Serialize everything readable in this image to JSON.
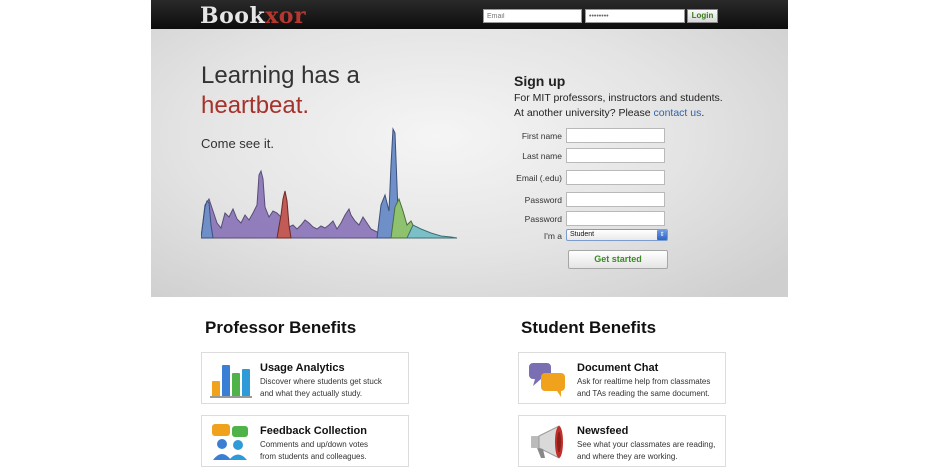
{
  "header": {
    "logo_main": "Book",
    "logo_accent": "xor",
    "email_placeholder": "Email",
    "password_mask": "••••••••",
    "login_label": "Login"
  },
  "hero": {
    "headline_line1": "Learning has a",
    "headline_line2": "heartbeat.",
    "come_see": "Come see it."
  },
  "signup": {
    "title": "Sign up",
    "subtitle_line1": "For MIT professors, instructors and students.",
    "subtitle_prefix": "At another university? Please ",
    "contact_link": "contact us",
    "subtitle_suffix": ".",
    "fields": [
      {
        "label": "First name"
      },
      {
        "label": "Last name"
      },
      {
        "label": "Email (.edu)"
      },
      {
        "label": "Password"
      },
      {
        "label": "Password"
      }
    ],
    "role_label": "I'm a",
    "role_value": "Student",
    "submit_label": "Get started"
  },
  "benefits": {
    "professor_title": "Professor Benefits",
    "student_title": "Student Benefits",
    "professor_items": [
      {
        "title": "Usage Analytics",
        "desc_line1": "Discover where students get stuck",
        "desc_line2": "and what they actually study.",
        "icon": "bar-chart-icon"
      },
      {
        "title": "Feedback Collection",
        "desc_line1": "Comments and up/down votes",
        "desc_line2": "from students and colleagues.",
        "icon": "people-chat-icon"
      }
    ],
    "student_items": [
      {
        "title": "Document Chat",
        "desc_line1": "Ask for realtime help from classmates",
        "desc_line2": "and TAs reading the same document.",
        "icon": "chat-bubbles-icon"
      },
      {
        "title": "Newsfeed",
        "desc_line1": "See what your classmates are reading,",
        "desc_line2": "and where they are working.",
        "icon": "megaphone-icon"
      }
    ]
  },
  "colors": {
    "brand_red": "#a5322c",
    "link_blue": "#2e63a8",
    "button_green": "#3b8a22"
  }
}
